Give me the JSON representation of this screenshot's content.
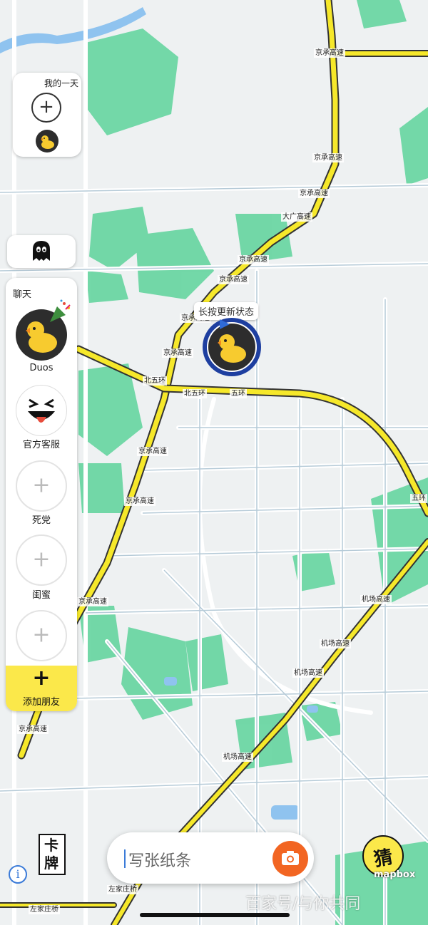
{
  "map": {
    "road_labels": [
      "京承高速",
      "京承高速",
      "京承高速",
      "大广高速",
      "京承高速",
      "京承高速",
      "京承高速",
      "京承高速",
      "北五环",
      "北五环",
      "五环",
      "京承高速",
      "京承高速",
      "京承高速",
      "五环",
      "机场高速",
      "机场高速",
      "机场高速",
      "机场高速",
      "京承高速",
      "左家庄桥",
      "左家庄桥"
    ],
    "attribution": "mapbox",
    "info_icon": "i"
  },
  "my_day": {
    "title": "我的一天"
  },
  "chat": {
    "header": "聊天",
    "items": [
      {
        "label": "Duos"
      },
      {
        "label": "官方客服"
      },
      {
        "label": "死党"
      },
      {
        "label": "闺蜜"
      },
      {
        "label": ""
      }
    ],
    "add_friend_label": "添加朋友"
  },
  "status_bubble": "长按更新状态",
  "card_button": "卡牌",
  "note_input": {
    "placeholder": "写张纸条"
  },
  "guess_button": "猜",
  "watermark": "百家号/与你共同"
}
